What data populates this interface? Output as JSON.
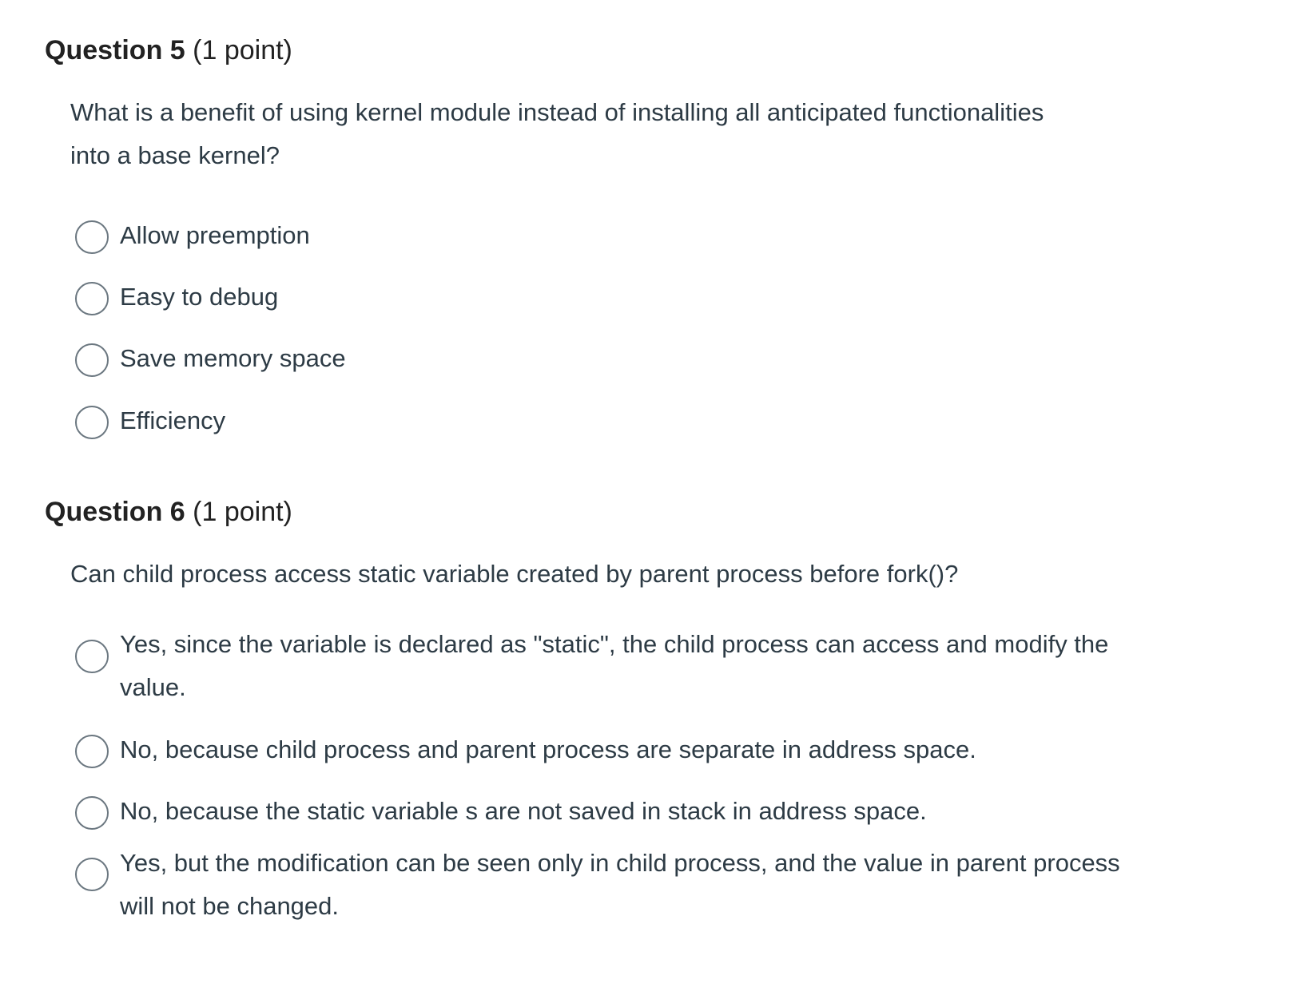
{
  "questions": [
    {
      "title": "Question 5",
      "points": "(1 point)",
      "text": "What is a benefit of using kernel module instead of installing all anticipated functionalities into a base kernel?",
      "options": [
        "Allow preemption",
        "Easy to debug",
        "Save memory space",
        "Efficiency"
      ]
    },
    {
      "title": "Question 6",
      "points": "(1 point)",
      "text": "Can child process access static variable created by parent process before fork()?",
      "options": [
        "Yes, since the variable is declared as \"static\", the child process can access and modify the value.",
        "No, because child process and parent process are separate in address space.",
        "No, because the static variable s are not saved in stack in address space.",
        "Yes, but the modification can be seen only in child process, and the value in parent process will not be changed."
      ]
    }
  ]
}
